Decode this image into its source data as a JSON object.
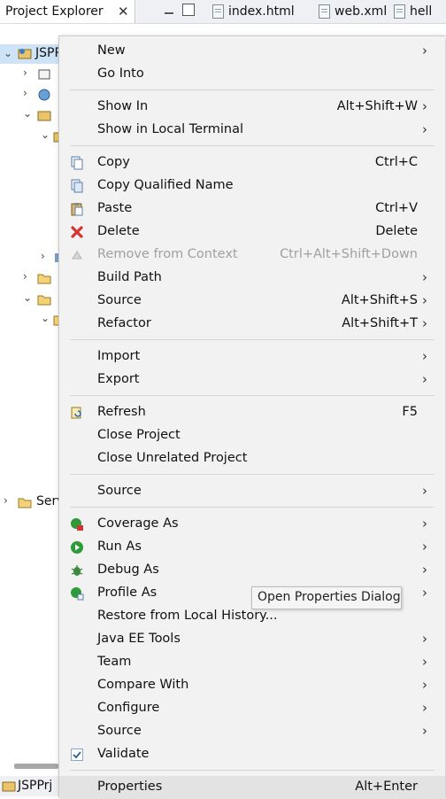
{
  "explorer": {
    "tab_label": "Project Explorer",
    "close_glyph": "✕",
    "project_label": "JSPP",
    "server_label": "Serv",
    "bottom_label": "JSPPrj"
  },
  "editor_tabs": [
    {
      "label": "index.html"
    },
    {
      "label": "web.xml"
    },
    {
      "label": "hell"
    }
  ],
  "menu": {
    "items": [
      {
        "label": "New",
        "shortcut": "",
        "submenu": true
      },
      {
        "label": "Go Into",
        "shortcut": "",
        "submenu": false
      },
      {
        "label": "Show In",
        "shortcut": "Alt+Shift+W",
        "submenu": true
      },
      {
        "label": "Show in Local Terminal",
        "shortcut": "",
        "submenu": true
      },
      {
        "label": "Copy",
        "shortcut": "Ctrl+C",
        "submenu": false,
        "icon": "copy-icon"
      },
      {
        "label": "Copy Qualified Name",
        "shortcut": "",
        "submenu": false,
        "icon": "copy-qualified-icon"
      },
      {
        "label": "Paste",
        "shortcut": "Ctrl+V",
        "submenu": false,
        "icon": "paste-icon"
      },
      {
        "label": "Delete",
        "shortcut": "Delete",
        "submenu": false,
        "icon": "delete-icon"
      },
      {
        "label": "Remove from Context",
        "shortcut": "Ctrl+Alt+Shift+Down",
        "submenu": false,
        "icon": "remove-context-icon",
        "disabled": true
      },
      {
        "label": "Build Path",
        "shortcut": "",
        "submenu": true
      },
      {
        "label": "Source",
        "shortcut": "Alt+Shift+S",
        "submenu": true
      },
      {
        "label": "Refactor",
        "shortcut": "Alt+Shift+T",
        "submenu": true
      },
      {
        "label": "Import",
        "shortcut": "",
        "submenu": true
      },
      {
        "label": "Export",
        "shortcut": "",
        "submenu": true
      },
      {
        "label": "Refresh",
        "shortcut": "F5",
        "submenu": false,
        "icon": "refresh-icon"
      },
      {
        "label": "Close Project",
        "shortcut": "",
        "submenu": false
      },
      {
        "label": "Close Unrelated Project",
        "shortcut": "",
        "submenu": false
      },
      {
        "label": "Source",
        "shortcut": "",
        "submenu": true
      },
      {
        "label": "Coverage As",
        "shortcut": "",
        "submenu": true,
        "icon": "coverage-icon"
      },
      {
        "label": "Run As",
        "shortcut": "",
        "submenu": true,
        "icon": "run-icon"
      },
      {
        "label": "Debug As",
        "shortcut": "",
        "submenu": true,
        "icon": "debug-icon"
      },
      {
        "label": "Profile As",
        "shortcut": "",
        "submenu": true,
        "icon": "profile-icon"
      },
      {
        "label": "Restore from Local History...",
        "shortcut": "",
        "submenu": false
      },
      {
        "label": "Java EE Tools",
        "shortcut": "",
        "submenu": true
      },
      {
        "label": "Team",
        "shortcut": "",
        "submenu": true
      },
      {
        "label": "Compare With",
        "shortcut": "",
        "submenu": true
      },
      {
        "label": "Configure",
        "shortcut": "",
        "submenu": true
      },
      {
        "label": "Source",
        "shortcut": "",
        "submenu": true
      },
      {
        "label": "Validate",
        "shortcut": "",
        "submenu": false,
        "icon": "check-icon"
      },
      {
        "label": "Properties",
        "shortcut": "Alt+Enter",
        "submenu": false,
        "highlighted": true
      }
    ]
  },
  "tooltip": {
    "text": "Open Properties Dialog"
  },
  "colors": {
    "delete_red": "#d6322f",
    "run_green": "#2e9a3a",
    "highlight": "#e3e3e3",
    "menu_bg": "#f2f2f2"
  }
}
